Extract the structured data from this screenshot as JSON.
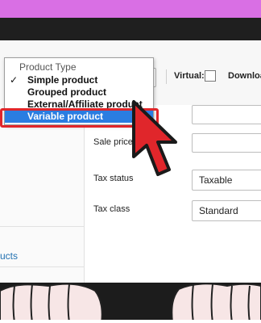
{
  "header": {
    "virtual_label": "Virtual:",
    "download_label": "Downloa"
  },
  "product_type_dropdown": {
    "group_label": "Product Type",
    "options": [
      {
        "label": "Simple product",
        "checked": true
      },
      {
        "label": "Grouped product",
        "checked": false
      },
      {
        "label": "External/Affiliate product",
        "checked": false
      },
      {
        "label": "Variable product",
        "highlighted": true
      }
    ]
  },
  "sidebar": {
    "link_text": "ucts"
  },
  "fields": {
    "sale_price_label": "Sale price ($",
    "tax_status_label": "Tax status",
    "tax_status_value": "Taxable",
    "tax_class_label": "Tax class",
    "tax_class_value": "Standard"
  },
  "colors": {
    "highlight": "#2a7de1",
    "annotation_red": "#e0262b",
    "link": "#2271b1"
  }
}
